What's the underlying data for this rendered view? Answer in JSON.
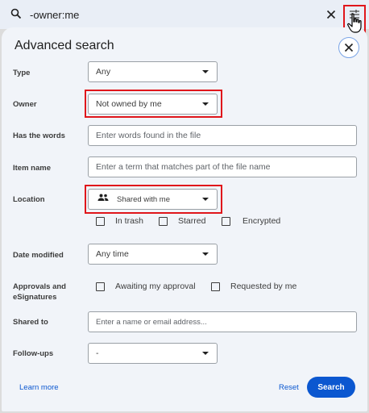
{
  "searchbar": {
    "query": "-owner:me",
    "icons": {
      "search": "search-icon",
      "clear": "close-icon",
      "filter": "tune-icon",
      "cursor": "hand-pointer-icon"
    }
  },
  "panel": {
    "title": "Advanced search",
    "close_icon": "close-icon"
  },
  "fields": {
    "type": {
      "label": "Type",
      "value": "Any"
    },
    "owner": {
      "label": "Owner",
      "value": "Not owned by me"
    },
    "has_words": {
      "label": "Has the words",
      "placeholder": "Enter words found in the file"
    },
    "item_name": {
      "label": "Item name",
      "placeholder": "Enter a term that matches part of the file name"
    },
    "location": {
      "label": "Location",
      "value": "Shared with me",
      "icon": "people-icon",
      "checkboxes": [
        "In trash",
        "Starred",
        "Encrypted"
      ]
    },
    "date_modified": {
      "label": "Date modified",
      "value": "Any time"
    },
    "approvals": {
      "label_line1": "Approvals and",
      "label_line2": "eSignatures",
      "checkboxes": [
        "Awaiting my approval",
        "Requested by me"
      ]
    },
    "shared_to": {
      "label": "Shared to",
      "placeholder": "Enter a name or email address..."
    },
    "follow_ups": {
      "label": "Follow-ups",
      "value": "-"
    }
  },
  "footer": {
    "learn_more": "Learn more",
    "reset": "Reset",
    "search": "Search"
  },
  "colors": {
    "accent": "#0b57d0",
    "highlight": "#e0161b",
    "panel_bg": "#f1f4f9"
  }
}
